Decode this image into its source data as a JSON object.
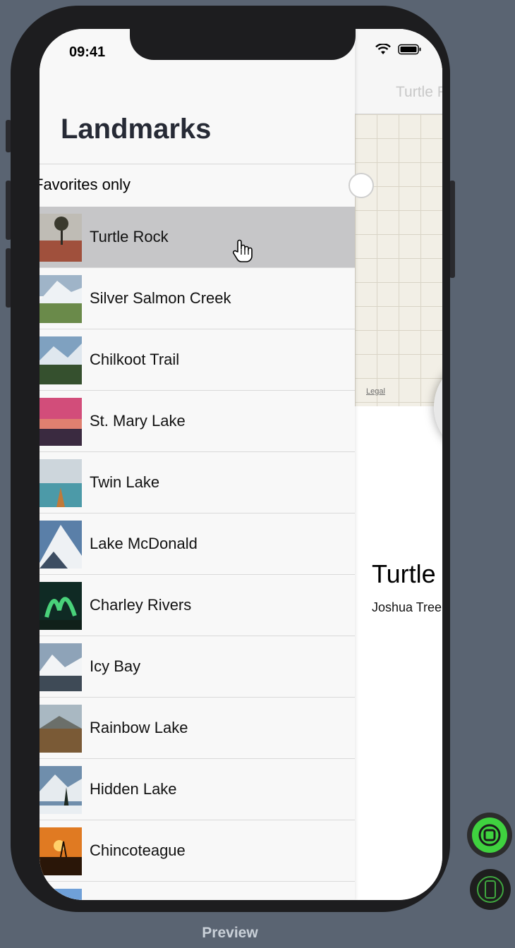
{
  "status_bar": {
    "time": "09:41"
  },
  "list": {
    "title": "Landmarks",
    "favorites_label": "Favorites only",
    "selected_index": 0,
    "rows": [
      {
        "name": "Turtle Rock"
      },
      {
        "name": "Silver Salmon Creek"
      },
      {
        "name": "Chilkoot Trail"
      },
      {
        "name": "St. Mary Lake"
      },
      {
        "name": "Twin Lake"
      },
      {
        "name": "Lake McDonald"
      },
      {
        "name": "Charley Rivers"
      },
      {
        "name": "Icy Bay"
      },
      {
        "name": "Rainbow Lake"
      },
      {
        "name": "Hidden Lake"
      },
      {
        "name": "Chincoteague"
      },
      {
        "name": ""
      }
    ]
  },
  "detail": {
    "nav_title": "Turtle Rock",
    "map_legal": "Legal",
    "title": "Turtle Rock",
    "subtitle": "Joshua Tree National Park"
  },
  "preview": {
    "label": "Preview"
  }
}
